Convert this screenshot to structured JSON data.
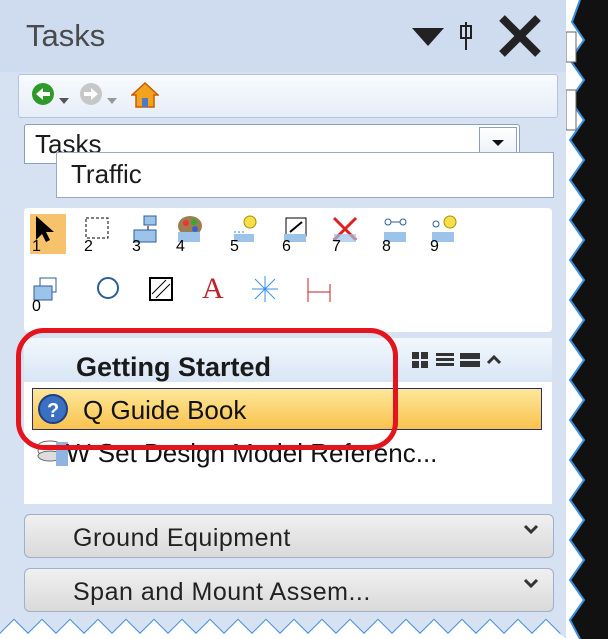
{
  "panel": {
    "title": "Tasks"
  },
  "dropdown": {
    "value": "Tasks",
    "sub_value": "Traffic"
  },
  "tools": {
    "numbers": [
      "1",
      "2",
      "3",
      "4",
      "5",
      "6",
      "7",
      "8",
      "9",
      "0"
    ]
  },
  "section": {
    "title": "Getting Started"
  },
  "items": [
    {
      "icon_letter": "Q",
      "label": "Guide Book"
    },
    {
      "icon_letter": "W",
      "label": "Set Design Model Referenc..."
    }
  ],
  "groups": [
    {
      "label": "Ground Equipment"
    },
    {
      "label": "Span and Mount Assem..."
    }
  ],
  "colors": {
    "highlight": "#e3141d",
    "selected": "#f9c24d",
    "panel": "#d6e2f2"
  }
}
